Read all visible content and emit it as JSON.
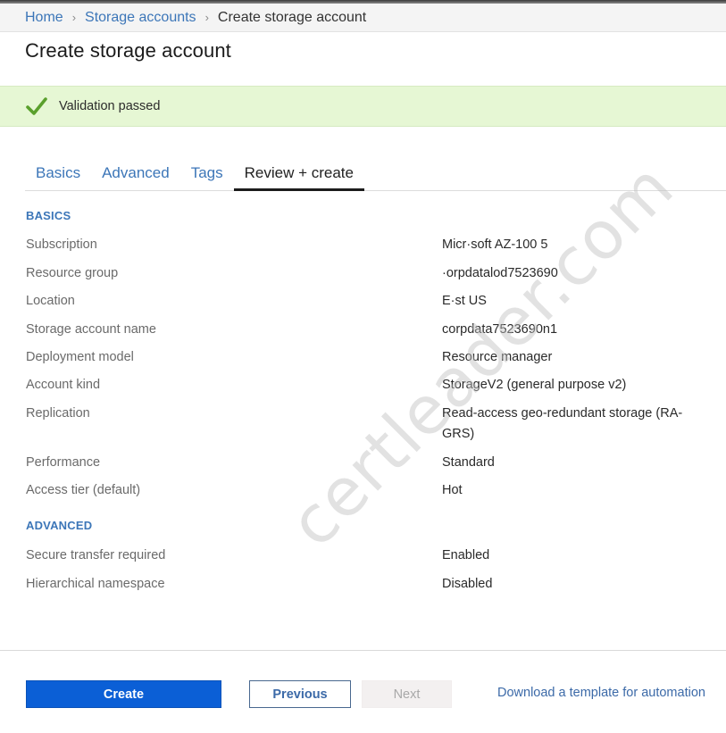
{
  "breadcrumb": {
    "items": [
      {
        "label": "Home"
      },
      {
        "label": "Storage accounts"
      },
      {
        "label": "Create storage account"
      }
    ],
    "separator": "›"
  },
  "page": {
    "title": "Create storage account"
  },
  "validation": {
    "status": "passed",
    "message": "Validation passed",
    "icon": "checkmark-icon",
    "color": "#5aa02c",
    "background": "#e6f7d4"
  },
  "tabs": [
    {
      "label": "Basics",
      "active": false
    },
    {
      "label": "Advanced",
      "active": false
    },
    {
      "label": "Tags",
      "active": false
    },
    {
      "label": "Review + create",
      "active": true
    }
  ],
  "sections": {
    "basics": {
      "heading": "BASICS",
      "rows": [
        {
          "label": "Subscription",
          "value": "Micr·soft AZ-100 5"
        },
        {
          "label": "Resource group",
          "value": "·orpdatalod7523690"
        },
        {
          "label": "Location",
          "value": "E·st US"
        },
        {
          "label": "Storage account name",
          "value": "corpdata7523690n1"
        },
        {
          "label": "Deployment model",
          "value": "Resource manager"
        },
        {
          "label": "Account kind",
          "value": "StorageV2 (general purpose v2)"
        },
        {
          "label": "Replication",
          "value": "Read-access geo-redundant storage (RA-GRS)"
        },
        {
          "label": "Performance",
          "value": "Standard"
        },
        {
          "label": "Access tier (default)",
          "value": "Hot"
        }
      ]
    },
    "advanced": {
      "heading": "ADVANCED",
      "rows": [
        {
          "label": "Secure transfer required",
          "value": "Enabled"
        },
        {
          "label": "Hierarchical namespace",
          "value": "Disabled"
        }
      ]
    }
  },
  "footer": {
    "create_label": "Create",
    "previous_label": "Previous",
    "next_label": "Next",
    "next_disabled": true,
    "template_link_label": "Download a template for automation"
  },
  "watermark": {
    "text": "certleader.com"
  },
  "colors": {
    "accent_link": "#3c76b8",
    "primary_button": "#0b5fd6",
    "success_banner": "#e6f7d4"
  }
}
